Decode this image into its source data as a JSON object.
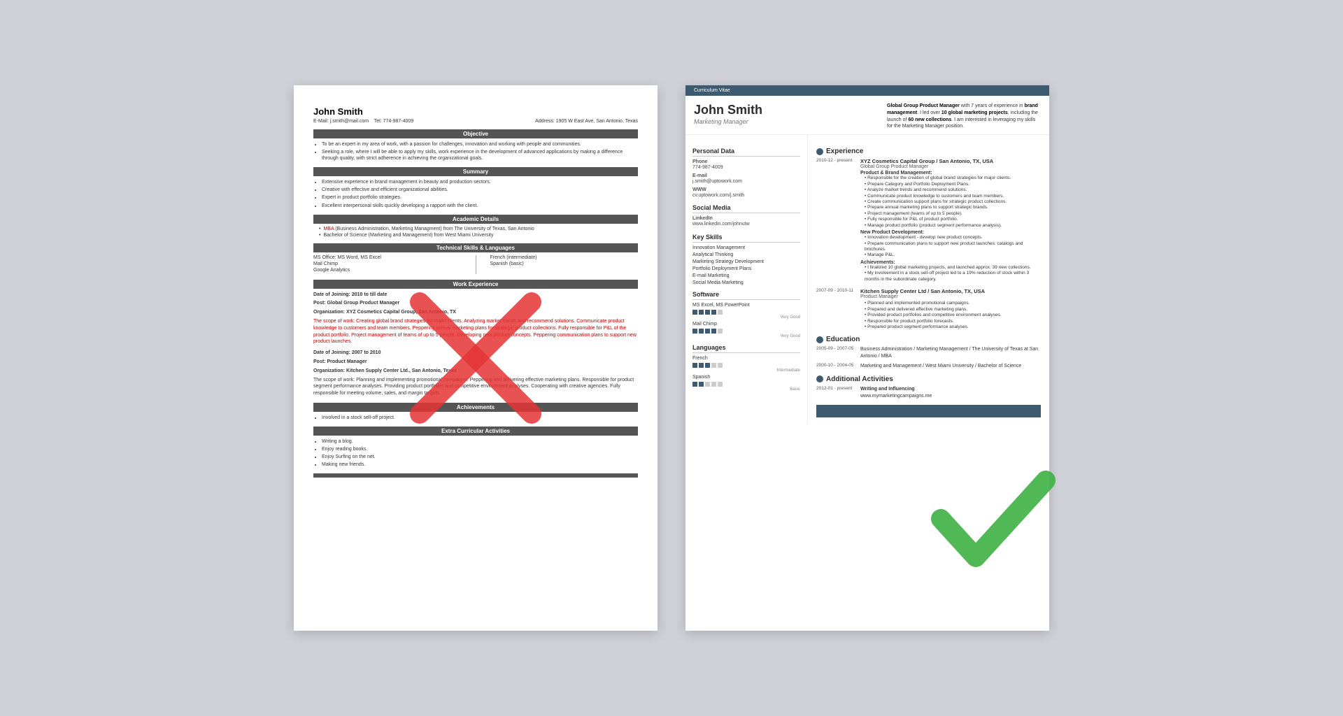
{
  "left_resume": {
    "name": "John Smith",
    "email_label": "E-Mail:",
    "email": "j.smith@mail.com",
    "tel_label": "Tel:",
    "tel": "774-987-4009",
    "address_label": "Address:",
    "address": "1905 W East Ave, San Antonio, Texas",
    "sections": {
      "objective": "Objective",
      "summary": "Summary",
      "academic": "Academic Details",
      "technical": "Technical Skills & Languages",
      "work": "Work Experience",
      "achievements": "Achievements",
      "extra": "Extra Curricular Activities"
    },
    "objective_bullets": [
      "To be an expert in my area of work, with a passion for challenges, innovation and working with people and communities.",
      "Seeking a role, where I will be able to apply my skills, work experience in the development of advanced applications by making a difference through quality, with strict adherence in achieving the organizational goals."
    ],
    "summary_bullets": [
      "Extensive experience in brand management in beauty and production sectors.",
      "Creative with effective and efficient organizational abilities.",
      "Expert in product portfolio strategies.",
      "Excellent interpersonal skills quickly developing a rapport with the client."
    ],
    "academic_items": [
      {
        "prefix": "MBA",
        "text": " (Business Administration, Marketing Managment) from The University of Texas, San Antonio"
      },
      {
        "prefix": "",
        "text": "Bachelor of Science (Marketing and Management) from West Miami University"
      }
    ],
    "skills_left": [
      "MS Office: MS Word, MS Excel",
      "Mail Chimp",
      "Google Analytics"
    ],
    "skills_right": [
      "French (intermediate)",
      "Spanish (basic)"
    ],
    "work_blocks": [
      {
        "date_joining": "Date of Joining: 2010 to till date",
        "post": "Post: Global Group Product Manager",
        "org": "Organization: XYZ Cosmetics Capital Group, San Antonio, TX",
        "scope": "The scope of work: Creating global brand strategies for major clients. Analyzing market trends and recommend solutions. Communicate product knowledge to customers and team members. Peppering annual marketing plans for strategic product collections. Fully responsible for P&L of the product portfolio. Project management of teams of up to 5 people. Developing new product concepts. Peppering communication plans to support new product launches."
      },
      {
        "date_joining": "Date of Joining: 2007 to 2010",
        "post": "Post: Product Manager",
        "org": "Organization: Kitchen Supply Center Ltd., San Antonio, Texas",
        "scope": "The scope of work: Planning and implementing promotional campaigns. Peppering and delivering effective marketing plans. Responsible for product segment performance analyses. Providing product portfolios and competitive environment analyses. Cooperating with creative agencies. Fully responsible for meeting volume, sales, and margin targets."
      }
    ],
    "achievements_bullets": [
      "Involved in a stock sell-off project."
    ],
    "extra_bullets": [
      "Writing a blog.",
      "Enjoy reading books.",
      "Enjoy Surfing on the net.",
      "Making new friends."
    ]
  },
  "right_resume": {
    "cv_label": "Curriculum Vitae",
    "name": "John Smith",
    "title": "Marketing Manager",
    "intro": "Global Group Product Manager with 7 years of experience in brand management. I led over 10 global marketing projects, including the launch of 60 new collections. I am interested in leveraging my skills for the Marketing Manager position.",
    "personal_data": {
      "section_title": "Personal Data",
      "phone_label": "Phone",
      "phone": "774-987-4009",
      "email_label": "E-mail",
      "email": "j.smith@uptowork.com",
      "www_label": "WWW",
      "www": "cv.uptowork.com/j.smith"
    },
    "social_media": {
      "section_title": "Social Media",
      "linkedin_label": "LinkedIn",
      "linkedin": "www.linkedin.com/johnutw"
    },
    "key_skills": {
      "section_title": "Key Skills",
      "items": [
        "Innovation Management",
        "Analytical Thinking",
        "Marketing Strategy Development",
        "Portfolio Deployment Plans",
        "E-mail Marketing",
        "Social Media Marketing"
      ]
    },
    "software": {
      "section_title": "Software",
      "items": [
        {
          "name": "MS Excel, MS PowerPoint",
          "level": 4,
          "max": 5,
          "label": "Very Good"
        },
        {
          "name": "Mail Chimp",
          "level": 4,
          "max": 5,
          "label": "Very Good"
        }
      ]
    },
    "languages": {
      "section_title": "Languages",
      "items": [
        {
          "name": "French",
          "level": 3,
          "max": 5,
          "label": "Intermediate"
        },
        {
          "name": "Spanish",
          "level": 2,
          "max": 5,
          "label": "Basic"
        }
      ]
    },
    "experience": {
      "section_title": "Experience",
      "items": [
        {
          "dates": "2010-12 - present",
          "company": "XYZ Cosmetics Capital Group / San Antonio, TX, USA",
          "role": "Global Group Product Manager",
          "subsections": [
            {
              "title": "Product & Brand Management:",
              "bullets": [
                "Responsible for the creation of global brand strategies for major clients.",
                "Prepare Category and Portfolio Deployment Plans.",
                "Analyze market trends and recommend solutions.",
                "Communicate product knowledge to customers and team members.",
                "Create communication support plans for strategic product collections.",
                "Prepare annual marketing plans to support strategic brands.",
                "Project management (teams of up to 5 people).",
                "Fully responsible for P&L of product portfolio.",
                "Manage product portfolio (product segment performance analysis)."
              ]
            },
            {
              "title": "New Product Development:",
              "bullets": [
                "Innovation development - develop new product concepts.",
                "Prepare communication plans to support new product launches: catalogs and brochures.",
                "Manage P&L."
              ]
            },
            {
              "title": "Achievements:",
              "bullets": [
                "I finalized 10 global marketing projects, and launched approx. 39 new collections.",
                "My involvement in a stock sell-off project led to a 19% reduction of stock within 3 months in the subordinate category."
              ]
            }
          ]
        },
        {
          "dates": "2007-09 - 2010-11",
          "company": "Kitchen Supply Center Ltd / San Antonio, TX, USA",
          "role": "Product Manager",
          "bullets": [
            "Planned and implemented promotional campaigns.",
            "Prepared and delivered effective marketing plans.",
            "Provided product portfolios and competitive environment analyses.",
            "Responsible for product portfolio forecasts.",
            "Prepared product segment performance analyses."
          ]
        }
      ]
    },
    "education": {
      "section_title": "Education",
      "items": [
        {
          "dates": "2005-09 - 2007-05",
          "text": "Business Administration / Marketing Management / The University of Texas at San Antonio / MBA"
        },
        {
          "dates": "2000-10 - 2004-05",
          "text": "Marketing and Management / West Miami University / Bachelor of Science"
        }
      ]
    },
    "additional": {
      "section_title": "Additional Activities",
      "items": [
        {
          "dates": "2012-01 - present",
          "title": "Writing and Influencing",
          "value": "www.mymarketingcampaigns.me"
        }
      ]
    }
  }
}
